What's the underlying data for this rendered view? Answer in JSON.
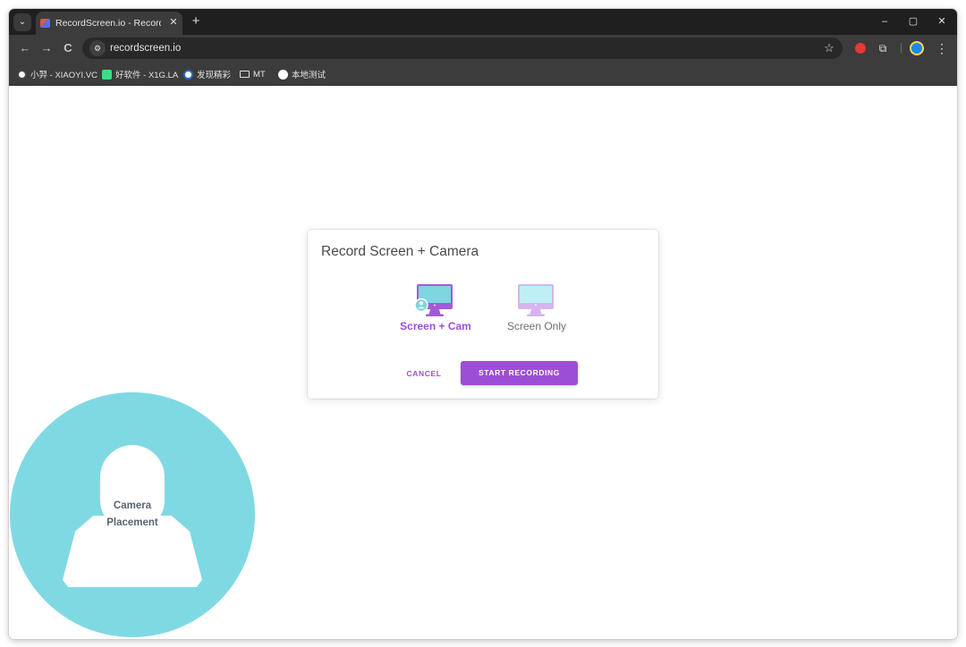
{
  "browser": {
    "tab": {
      "title": "RecordScreen.io - Record you",
      "close_glyph": "✕",
      "favicon": "recordscreen-favicon"
    },
    "tab_search_glyph": "⌄",
    "new_tab_glyph": "+",
    "window_controls": {
      "minimize": "–",
      "maximize": "▢",
      "close": "✕"
    },
    "nav": {
      "back": "←",
      "forward": "→",
      "reload": "C"
    },
    "omnibox": {
      "url": "recordscreen.io",
      "site_info_glyph": "⚙",
      "bookmark_glyph": "☆"
    },
    "toolbar_icons": {
      "extension_glyph": "⧉",
      "menu_glyph": "⋮"
    },
    "bookmarks": [
      {
        "label": "小羿 - XIAOYI.VC",
        "icon": "avatar-icon",
        "color": "#f5f5f5"
      },
      {
        "label": "好软件 - X1G.LA",
        "icon": "app-icon",
        "color": "#3ddc84"
      },
      {
        "label": "发现精彩",
        "icon": "wordpress-icon",
        "color": "#ffffff"
      },
      {
        "label": "MT",
        "icon": "folder-icon",
        "color": "#e3e3e3"
      },
      {
        "label": "本地测试",
        "icon": "globe-icon",
        "color": "#ffffff"
      }
    ]
  },
  "dialog": {
    "title": "Record Screen + Camera",
    "options": [
      {
        "label": "Screen + Cam",
        "selected": true,
        "icon": "monitor-with-camera-icon"
      },
      {
        "label": "Screen Only",
        "selected": false,
        "icon": "monitor-icon"
      }
    ],
    "cancel_label": "CANCEL",
    "start_label": "START RECORDING"
  },
  "camera_preview": {
    "label_line1": "Camera",
    "label_line2": "Placement",
    "color": "#7fd9e3"
  },
  "colors": {
    "accent": "#9c4fd6",
    "monitor_active": "#a35ad9",
    "monitor_inactive": "#d7b4ef",
    "screen_fill_active": "#7ed6df",
    "screen_fill_inactive": "#bfeff3"
  }
}
